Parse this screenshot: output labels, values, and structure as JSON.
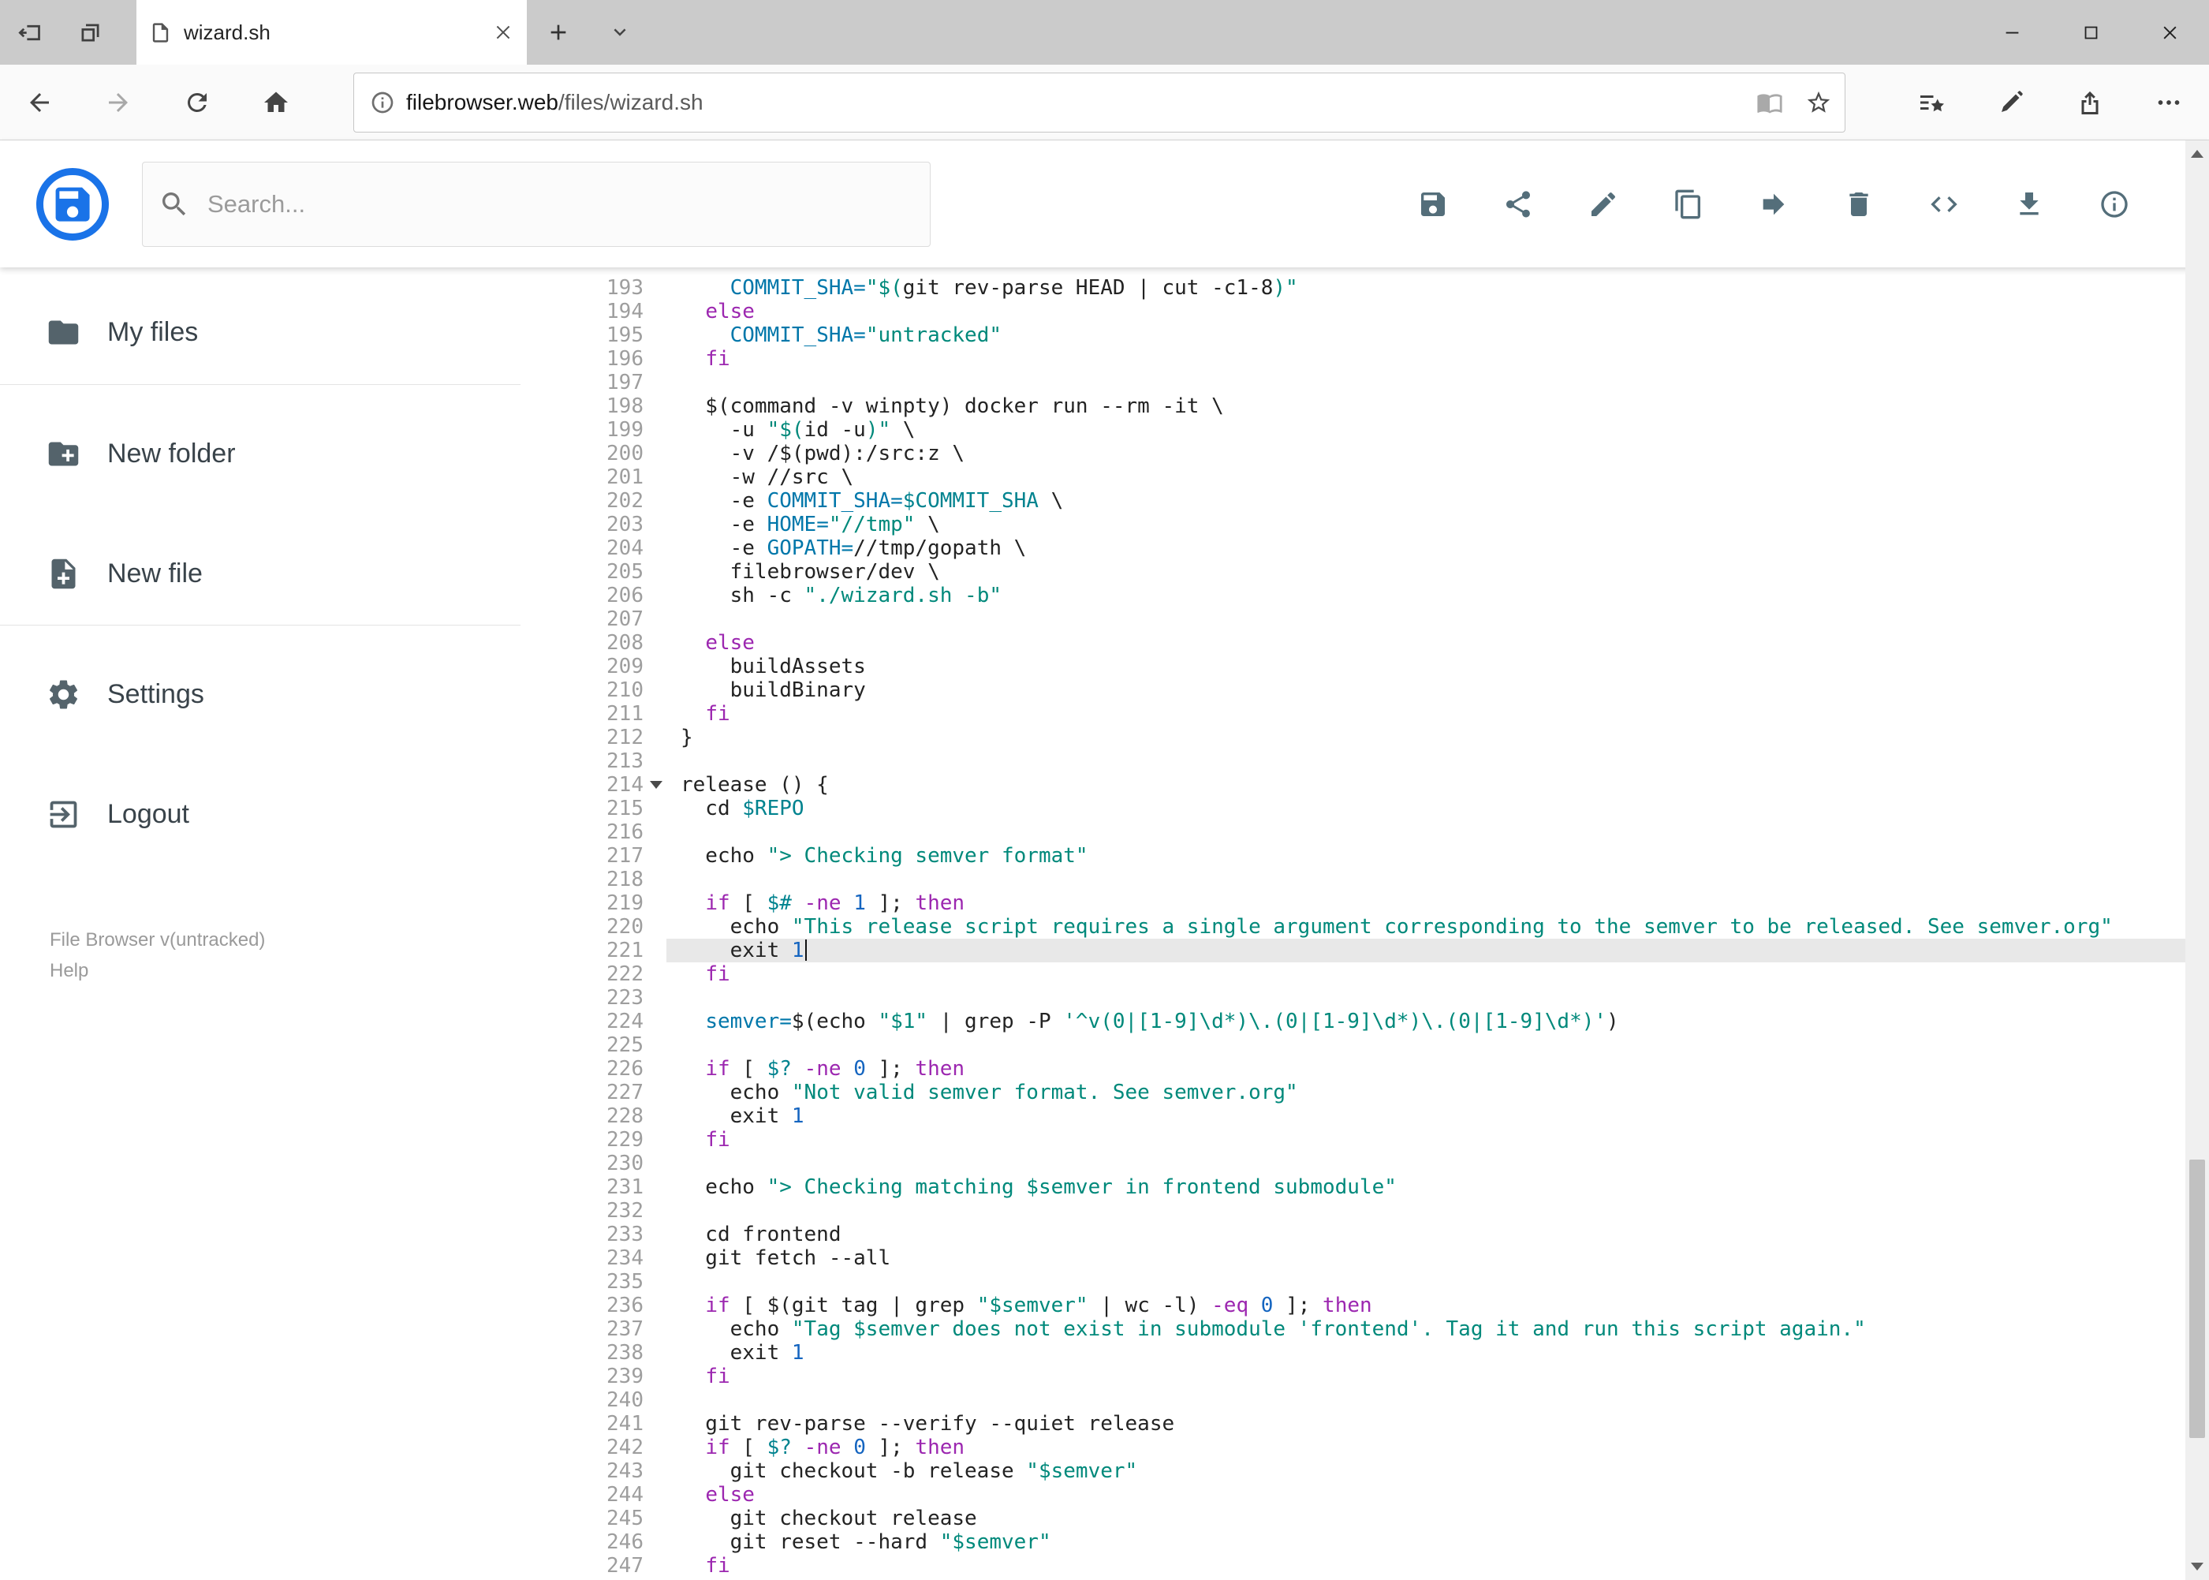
{
  "browser": {
    "tab_title": "wizard.sh",
    "url_domain": "filebrowser.web",
    "url_path": "/files/wizard.sh"
  },
  "header": {
    "search_placeholder": "Search...",
    "action_icons": [
      "save",
      "share",
      "edit",
      "copy",
      "move",
      "delete",
      "code",
      "download",
      "info"
    ]
  },
  "sidebar": {
    "items": [
      {
        "label": "My files",
        "icon": "folder"
      },
      {
        "label": "New folder",
        "icon": "create-new-folder"
      },
      {
        "label": "New file",
        "icon": "note-add"
      },
      {
        "label": "Settings",
        "icon": "settings-gear"
      },
      {
        "label": "Logout",
        "icon": "exit-to-app"
      }
    ],
    "version": "File Browser v(untracked)",
    "help": "Help"
  },
  "editor": {
    "first_line": 193,
    "active_line": 221,
    "fold_marker_line": 214,
    "lines": [
      "    COMMIT_SHA=\"$(git rev-parse HEAD | cut -c1-8)\"",
      "  else",
      "    COMMIT_SHA=\"untracked\"",
      "  fi",
      "",
      "  $(command -v winpty) docker run --rm -it \\",
      "    -u \"$(id -u)\" \\",
      "    -v /$(pwd):/src:z \\",
      "    -w //src \\",
      "    -e COMMIT_SHA=$COMMIT_SHA \\",
      "    -e HOME=\"//tmp\" \\",
      "    -e GOPATH=//tmp/gopath \\",
      "    filebrowser/dev \\",
      "    sh -c \"./wizard.sh -b\"",
      "",
      "  else",
      "    buildAssets",
      "    buildBinary",
      "  fi",
      "}",
      "",
      "release () {",
      "  cd $REPO",
      "",
      "  echo \"> Checking semver format\"",
      "",
      "  if [ $# -ne 1 ]; then",
      "    echo \"This release script requires a single argument corresponding to the semver to be released. See semver.org\"",
      "    exit 1",
      "  fi",
      "",
      "  semver=$(echo \"$1\" | grep -P '^v(0|[1-9]\\d*)\\.(0|[1-9]\\d*)\\.(0|[1-9]\\d*)')",
      "",
      "  if [ $? -ne 0 ]; then",
      "    echo \"Not valid semver format. See semver.org\"",
      "    exit 1",
      "  fi",
      "",
      "  echo \"> Checking matching $semver in frontend submodule\"",
      "",
      "  cd frontend",
      "  git fetch --all",
      "",
      "  if [ $(git tag | grep \"$semver\" | wc -l) -eq 0 ]; then",
      "    echo \"Tag $semver does not exist in submodule 'frontend'. Tag it and run this script again.\"",
      "    exit 1",
      "  fi",
      "",
      "  git rev-parse --verify --quiet release",
      "  if [ $? -ne 0 ]; then",
      "    git checkout -b release \"$semver\"",
      "  else",
      "    git checkout release",
      "    git reset --hard \"$semver\"",
      "  fi"
    ]
  },
  "colors": {
    "accent": "#1a73e8",
    "keyword": "#9c27b0",
    "string": "#00897b",
    "variable": "#00838f",
    "definition": "#0077aa",
    "number": "#1565c0",
    "active_line_bg": "#e8e8e8"
  }
}
